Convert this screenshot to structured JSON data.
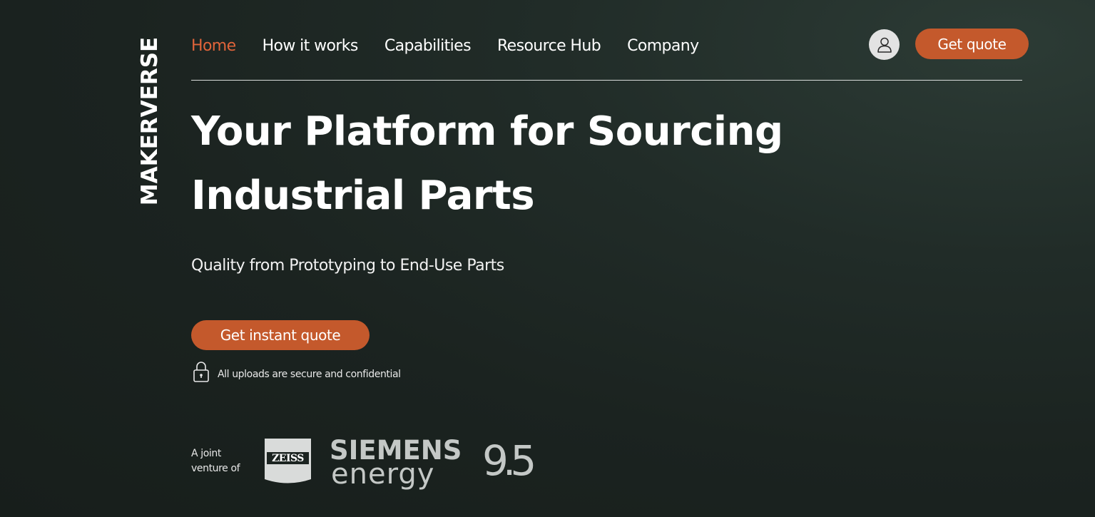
{
  "brand": {
    "name": "MAKERVERSE"
  },
  "nav": {
    "items": [
      {
        "label": "Home",
        "active": true
      },
      {
        "label": "How it works",
        "active": false
      },
      {
        "label": "Capabilities",
        "active": false
      },
      {
        "label": "Resource Hub",
        "active": false
      },
      {
        "label": "Company",
        "active": false
      }
    ],
    "account_icon": "user-icon",
    "quote_label": "Get quote"
  },
  "hero": {
    "title": "Your Platform for Sourcing Industrial Parts",
    "subtitle": "Quality from Prototyping to End-Use Parts",
    "cta_label": "Get instant quote",
    "security_icon": "lock-icon",
    "security_note": "All uploads are secure and confidential"
  },
  "partners": {
    "intro_line1": "A joint",
    "intro_line2": "venture of",
    "logos": [
      {
        "name": "ZEISS"
      },
      {
        "name": "SIEMENS",
        "sub": "energy"
      },
      {
        "name": "9.5"
      }
    ]
  },
  "colors": {
    "accent": "#c4592c",
    "active_nav": "#e0643a",
    "background": "#1b2320"
  }
}
